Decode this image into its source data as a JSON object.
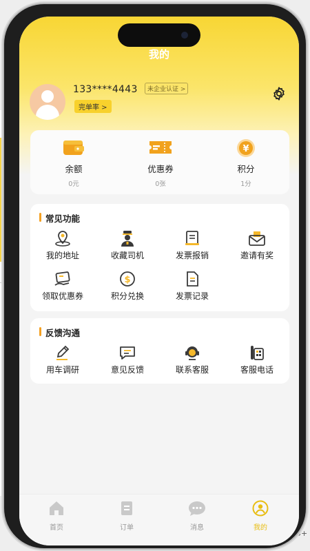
{
  "header": {
    "title": "我的"
  },
  "user": {
    "phone": "133****4443",
    "cert_label": "未企业认证 >",
    "completion_label": "完单率 >"
  },
  "stats": [
    {
      "label": "余额",
      "value": "0元",
      "icon": "wallet-icon"
    },
    {
      "label": "优惠券",
      "value": "0张",
      "icon": "coupon-ticket-icon"
    },
    {
      "label": "积分",
      "value": "1分",
      "icon": "yen-coin-icon",
      "glyph": "¥"
    }
  ],
  "common": {
    "title": "常见功能",
    "items": [
      {
        "label": "我的地址",
        "icon": "location-pin-icon"
      },
      {
        "label": "收藏司机",
        "icon": "driver-icon"
      },
      {
        "label": "发票报销",
        "icon": "invoice-icon"
      },
      {
        "label": "邀请有奖",
        "icon": "invite-envelope-icon"
      },
      {
        "label": "领取优惠券",
        "icon": "receive-coupon-icon"
      },
      {
        "label": "积分兑换",
        "icon": "points-exchange-icon",
        "glyph": "$"
      },
      {
        "label": "发票记录",
        "icon": "invoice-record-icon"
      }
    ]
  },
  "feedback": {
    "title": "反馈沟通",
    "items": [
      {
        "label": "用车调研",
        "icon": "survey-pen-icon"
      },
      {
        "label": "意见反馈",
        "icon": "chat-bubble-icon"
      },
      {
        "label": "联系客服",
        "icon": "customer-service-icon"
      },
      {
        "label": "客服电话",
        "icon": "phone-icon"
      }
    ]
  },
  "tabbar": {
    "tabs": [
      {
        "label": "首页",
        "icon": "home-icon",
        "active": false
      },
      {
        "label": "订单",
        "icon": "order-doc-icon",
        "active": false
      },
      {
        "label": "消息",
        "icon": "message-icon",
        "active": false
      },
      {
        "label": "我的",
        "icon": "profile-icon",
        "active": true
      }
    ]
  },
  "colors": {
    "accent": "#f8d634",
    "icon_dark": "#3a3a3a",
    "icon_yellow": "#f5b82a",
    "active_tab": "#e8bd12"
  },
  "stray_text": "5+"
}
